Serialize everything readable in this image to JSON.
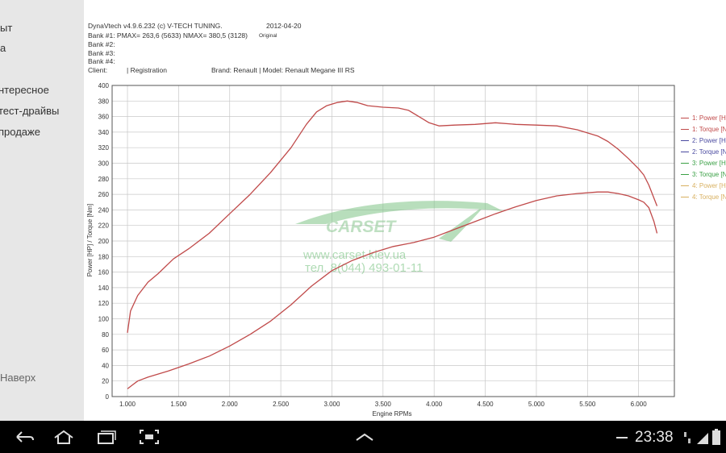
{
  "sidebar": {
    "items_top": [
      "ыт",
      "а"
    ],
    "items": [
      "нтересное",
      "тест-драйвы",
      "продаже"
    ],
    "back_to_top": "Наверх"
  },
  "header": {
    "software": "DynaVtech v4.9.6.232 (c) V-TECH TUNING.",
    "date": "2012-04-20",
    "bank1": "Bank #1:  PMAX= 263,6 (5633)    NMAX= 380,5 (3128)",
    "bank1_tag": "Original",
    "bank2": "Bank #2:",
    "bank3": "Bank #3:",
    "bank4": "Bank #4:",
    "client": "Client:",
    "registration": "| Registration",
    "brand": "Brand: Renault | Model: Renault Megane III RS"
  },
  "watermark": {
    "logo": "CARSET",
    "url": "www.carset.kiev.ua",
    "phone": "тел. 8(044) 493-01-11"
  },
  "status_bar": {
    "time": "23:38"
  },
  "chart_data": {
    "type": "line",
    "title": "",
    "xlabel": "Engine RPMs",
    "ylabel": "Power [HP] / Torque [Nm]",
    "xlim": [
      850,
      6350
    ],
    "ylim": [
      0,
      400
    ],
    "x_ticks": [
      1000,
      1500,
      2000,
      2500,
      3000,
      3500,
      4000,
      4500,
      5000,
      5500,
      6000
    ],
    "x_tick_labels": [
      "1.000",
      "1.500",
      "2.000",
      "2.500",
      "3.000",
      "3.500",
      "4.000",
      "4.500",
      "5.000",
      "5.500",
      "6.000"
    ],
    "y_ticks": [
      0,
      20,
      40,
      60,
      80,
      100,
      120,
      140,
      160,
      180,
      200,
      220,
      240,
      260,
      280,
      300,
      320,
      340,
      360,
      380,
      400
    ],
    "grid": true,
    "legend_position": "right",
    "legend": [
      "1: Power [H",
      "1: Torque [N",
      "2: Power [H",
      "2: Torque [N",
      "3: Power [H",
      "3: Torque [N",
      "4: Power [H",
      "4: Torque [N"
    ],
    "legend_colors": [
      "#c04a4a",
      "#c04a4a",
      "#4a4aa0",
      "#4a4aa0",
      "#3aa045",
      "#3aa045",
      "#d8b060",
      "#d8b060"
    ],
    "series": [
      {
        "name": "1: Torque [N",
        "color": "#c04a4a",
        "x": [
          1000,
          1030,
          1100,
          1200,
          1300,
          1450,
          1600,
          1800,
          2000,
          2200,
          2400,
          2600,
          2750,
          2850,
          2950,
          3050,
          3150,
          3250,
          3350,
          3500,
          3650,
          3750,
          3850,
          3950,
          4050,
          4200,
          4400,
          4600,
          4800,
          5000,
          5200,
          5400,
          5600,
          5700,
          5800,
          5900,
          6000,
          6050,
          6100,
          6150,
          6180
        ],
        "y": [
          82,
          110,
          130,
          147,
          158,
          177,
          190,
          210,
          235,
          260,
          288,
          320,
          350,
          366,
          374,
          378,
          380,
          378,
          374,
          372,
          371,
          368,
          360,
          352,
          348,
          349,
          350,
          352,
          350,
          349,
          348,
          343,
          335,
          328,
          318,
          306,
          293,
          285,
          272,
          255,
          245
        ]
      },
      {
        "name": "1: Power [H",
        "color": "#c04a4a",
        "x": [
          1000,
          1050,
          1100,
          1200,
          1400,
          1600,
          1800,
          2000,
          2200,
          2400,
          2600,
          2800,
          3000,
          3200,
          3400,
          3600,
          3800,
          4000,
          4200,
          4400,
          4600,
          4800,
          5000,
          5200,
          5400,
          5600,
          5700,
          5800,
          5900,
          6000,
          6050,
          6100,
          6150,
          6180
        ],
        "y": [
          10,
          15,
          20,
          25,
          33,
          42,
          52,
          65,
          80,
          97,
          118,
          142,
          162,
          175,
          185,
          193,
          198,
          205,
          215,
          225,
          235,
          244,
          252,
          258,
          261,
          263,
          263,
          261,
          258,
          253,
          250,
          243,
          225,
          210
        ]
      }
    ]
  }
}
